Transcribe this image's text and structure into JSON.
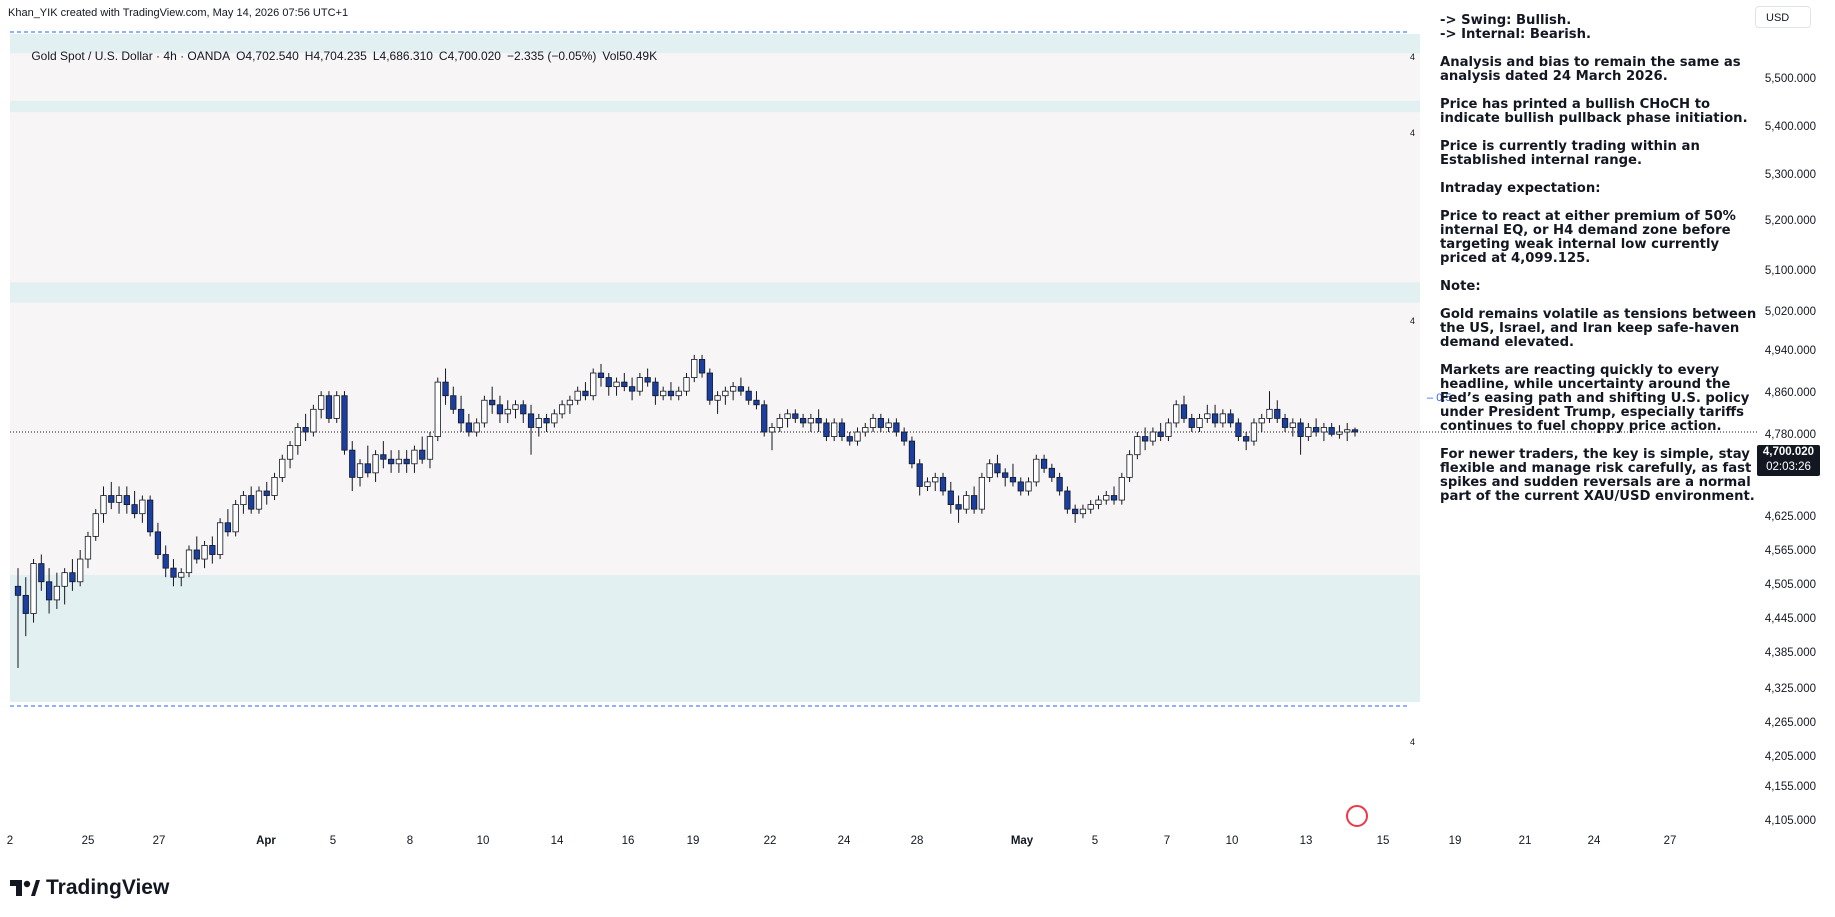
{
  "header": {
    "attribution": "Khan_YIK created with TradingView.com, May 14, 2026 07:56 UTC+1"
  },
  "symbol": {
    "name": "Gold Spot / U.S. Dollar · 4h · OANDA",
    "open": "O4,702.540",
    "high": "H4,704.235",
    "low": "L4,686.310",
    "close": "C4,700.020",
    "change": "−2.335 (−0.05%)",
    "volume": "Vol50.49K"
  },
  "currency": "USD",
  "price_axis": {
    "labels": [
      "5,500.000",
      "5,400.000",
      "5,300.000",
      "5,200.000",
      "5,100.000",
      "5,020.000",
      "4,940.000",
      "4,860.000",
      "4,780.000",
      "4,700.000",
      "4,625.000",
      "4,565.000",
      "4,505.000",
      "4,445.000",
      "4,385.000",
      "4,325.000",
      "4,265.000",
      "4,205.000",
      "4,155.000",
      "4,105.000"
    ],
    "last_price": "4,700.020",
    "countdown": "02:03:26"
  },
  "time_axis": {
    "labels": [
      {
        "text": "2",
        "bold": false
      },
      {
        "text": "25",
        "bold": false
      },
      {
        "text": "27",
        "bold": false
      },
      {
        "text": "Apr",
        "bold": true
      },
      {
        "text": "5",
        "bold": false
      },
      {
        "text": "8",
        "bold": false
      },
      {
        "text": "10",
        "bold": false
      },
      {
        "text": "14",
        "bold": false
      },
      {
        "text": "16",
        "bold": false
      },
      {
        "text": "19",
        "bold": false
      },
      {
        "text": "22",
        "bold": false
      },
      {
        "text": "24",
        "bold": false
      },
      {
        "text": "28",
        "bold": false
      },
      {
        "text": "May",
        "bold": true
      },
      {
        "text": "5",
        "bold": false
      },
      {
        "text": "7",
        "bold": false
      },
      {
        "text": "10",
        "bold": false
      },
      {
        "text": "13",
        "bold": false
      },
      {
        "text": "15",
        "bold": false
      },
      {
        "text": "19",
        "bold": false
      },
      {
        "text": "21",
        "bold": false
      },
      {
        "text": "24",
        "bold": false
      },
      {
        "text": "27",
        "bold": false
      }
    ]
  },
  "fib_level": "0.5",
  "zone_labels": [
    "4",
    "4",
    "4",
    "4"
  ],
  "analysis": {
    "lines": [
      "-> Swing:  Bullish.",
      "-> Internal:  Bearish.",
      "Analysis and bias to remain the same as analysis dated 24 March 2026.",
      "Price has printed a bullish CHoCH to indicate bullish pullback phase initiation.",
      "Price is currently trading within an Established internal range.",
      "Intraday expectation:",
      "Price to react at either premium of 50% internal EQ, or H4 demand zone before targeting weak internal low currently priced at 4,099.125.",
      "Note:",
      "Gold remains volatile as tensions between the US, Israel, and Iran keep safe-haven demand elevated.",
      "Markets are reacting quickly to every headline, while uncertainty around the Fed’s easing path and shifting U.S. policy under President Trump, especially tariffs continues to fuel choppy price action.",
      "For newer traders, the key is simple, stay flexible and manage risk carefully, as fast spikes and sudden reversals are a normal part of the current XAU/USD environment."
    ]
  },
  "footer": {
    "brand": "TradingView"
  },
  "colors": {
    "up": "#ffffff",
    "down": "#1a3fa0",
    "wick": "#131722",
    "zone": "#e3f0f2",
    "range_bg": "#f7f5f6",
    "dashed": "#2962ff"
  },
  "chart_data": {
    "type": "candlestick",
    "symbol": "XAUUSD",
    "interval": "4h",
    "ylim": [
      4105,
      5500
    ],
    "last": 4700.02,
    "zones": [
      {
        "top": 5580,
        "bottom": 5535
      },
      {
        "top": 5430,
        "bottom": 5405
      },
      {
        "top": 5030,
        "bottom": 4985
      },
      {
        "top": 4385,
        "bottom": 4105
      }
    ],
    "range_box": {
      "top": 5535,
      "bottom": 4385
    },
    "fib_mid": 4843,
    "candles": [
      [
        4360,
        4400,
        4180,
        4340
      ],
      [
        4340,
        4380,
        4250,
        4300
      ],
      [
        4300,
        4420,
        4280,
        4410
      ],
      [
        4410,
        4430,
        4350,
        4370
      ],
      [
        4370,
        4400,
        4300,
        4330
      ],
      [
        4330,
        4390,
        4310,
        4360
      ],
      [
        4360,
        4400,
        4320,
        4390
      ],
      [
        4390,
        4420,
        4350,
        4370
      ],
      [
        4370,
        4440,
        4360,
        4420
      ],
      [
        4420,
        4480,
        4400,
        4470
      ],
      [
        4470,
        4530,
        4460,
        4520
      ],
      [
        4520,
        4580,
        4500,
        4560
      ],
      [
        4560,
        4590,
        4530,
        4545
      ],
      [
        4545,
        4580,
        4520,
        4560
      ],
      [
        4560,
        4580,
        4520,
        4540
      ],
      [
        4540,
        4570,
        4510,
        4520
      ],
      [
        4520,
        4560,
        4500,
        4550
      ],
      [
        4550,
        4560,
        4470,
        4480
      ],
      [
        4480,
        4500,
        4420,
        4430
      ],
      [
        4430,
        4450,
        4380,
        4400
      ],
      [
        4400,
        4420,
        4360,
        4380
      ],
      [
        4380,
        4400,
        4360,
        4390
      ],
      [
        4390,
        4450,
        4380,
        4440
      ],
      [
        4440,
        4470,
        4410,
        4420
      ],
      [
        4420,
        4460,
        4400,
        4450
      ],
      [
        4450,
        4470,
        4410,
        4430
      ],
      [
        4430,
        4510,
        4420,
        4500
      ],
      [
        4500,
        4530,
        4470,
        4480
      ],
      [
        4480,
        4550,
        4470,
        4540
      ],
      [
        4540,
        4570,
        4520,
        4560
      ],
      [
        4560,
        4580,
        4520,
        4530
      ],
      [
        4530,
        4580,
        4520,
        4570
      ],
      [
        4570,
        4590,
        4540,
        4560
      ],
      [
        4560,
        4610,
        4550,
        4600
      ],
      [
        4600,
        4650,
        4590,
        4640
      ],
      [
        4640,
        4680,
        4620,
        4670
      ],
      [
        4670,
        4720,
        4650,
        4710
      ],
      [
        4710,
        4740,
        4680,
        4700
      ],
      [
        4700,
        4760,
        4690,
        4750
      ],
      [
        4750,
        4790,
        4730,
        4780
      ],
      [
        4780,
        4790,
        4720,
        4730
      ],
      [
        4730,
        4790,
        4720,
        4780
      ],
      [
        4780,
        4790,
        4650,
        4660
      ],
      [
        4660,
        4680,
        4570,
        4600
      ],
      [
        4600,
        4640,
        4580,
        4630
      ],
      [
        4630,
        4670,
        4600,
        4610
      ],
      [
        4610,
        4660,
        4590,
        4650
      ],
      [
        4650,
        4680,
        4620,
        4640
      ],
      [
        4640,
        4660,
        4610,
        4630
      ],
      [
        4630,
        4660,
        4610,
        4640
      ],
      [
        4640,
        4660,
        4610,
        4630
      ],
      [
        4630,
        4670,
        4610,
        4660
      ],
      [
        4660,
        4690,
        4630,
        4640
      ],
      [
        4640,
        4700,
        4620,
        4690
      ],
      [
        4690,
        4820,
        4680,
        4810
      ],
      [
        4810,
        4840,
        4760,
        4780
      ],
      [
        4780,
        4800,
        4740,
        4750
      ],
      [
        4750,
        4780,
        4700,
        4720
      ],
      [
        4720,
        4740,
        4690,
        4700
      ],
      [
        4700,
        4730,
        4690,
        4720
      ],
      [
        4720,
        4780,
        4710,
        4770
      ],
      [
        4770,
        4800,
        4740,
        4760
      ],
      [
        4760,
        4780,
        4720,
        4740
      ],
      [
        4740,
        4770,
        4720,
        4750
      ],
      [
        4750,
        4770,
        4730,
        4760
      ],
      [
        4760,
        4770,
        4720,
        4740
      ],
      [
        4740,
        4760,
        4650,
        4710
      ],
      [
        4710,
        4740,
        4690,
        4730
      ],
      [
        4730,
        4740,
        4700,
        4720
      ],
      [
        4720,
        4750,
        4710,
        4740
      ],
      [
        4740,
        4770,
        4730,
        4760
      ],
      [
        4760,
        4780,
        4740,
        4770
      ],
      [
        4770,
        4800,
        4760,
        4790
      ],
      [
        4790,
        4810,
        4770,
        4780
      ],
      [
        4780,
        4840,
        4770,
        4830
      ],
      [
        4830,
        4850,
        4800,
        4820
      ],
      [
        4820,
        4830,
        4780,
        4800
      ],
      [
        4800,
        4820,
        4780,
        4810
      ],
      [
        4810,
        4830,
        4790,
        4800
      ],
      [
        4800,
        4820,
        4770,
        4790
      ],
      [
        4790,
        4830,
        4780,
        4820
      ],
      [
        4820,
        4840,
        4800,
        4810
      ],
      [
        4810,
        4820,
        4760,
        4780
      ],
      [
        4780,
        4800,
        4770,
        4790
      ],
      [
        4790,
        4810,
        4770,
        4780
      ],
      [
        4780,
        4800,
        4770,
        4790
      ],
      [
        4790,
        4830,
        4780,
        4820
      ],
      [
        4820,
        4870,
        4810,
        4860
      ],
      [
        4860,
        4870,
        4820,
        4830
      ],
      [
        4830,
        4840,
        4760,
        4770
      ],
      [
        4770,
        4790,
        4740,
        4780
      ],
      [
        4780,
        4800,
        4760,
        4790
      ],
      [
        4790,
        4810,
        4770,
        4800
      ],
      [
        4800,
        4820,
        4780,
        4790
      ],
      [
        4790,
        4800,
        4760,
        4770
      ],
      [
        4770,
        4790,
        4750,
        4760
      ],
      [
        4760,
        4770,
        4690,
        4700
      ],
      [
        4700,
        4720,
        4660,
        4710
      ],
      [
        4710,
        4740,
        4700,
        4730
      ],
      [
        4730,
        4750,
        4710,
        4740
      ],
      [
        4740,
        4750,
        4720,
        4730
      ],
      [
        4730,
        4740,
        4710,
        4720
      ],
      [
        4720,
        4740,
        4700,
        4730
      ],
      [
        4730,
        4750,
        4700,
        4720
      ],
      [
        4720,
        4730,
        4680,
        4690
      ],
      [
        4690,
        4730,
        4680,
        4720
      ],
      [
        4720,
        4730,
        4680,
        4690
      ],
      [
        4690,
        4700,
        4670,
        4680
      ],
      [
        4680,
        4710,
        4670,
        4700
      ],
      [
        4700,
        4720,
        4690,
        4710
      ],
      [
        4710,
        4740,
        4700,
        4730
      ],
      [
        4730,
        4740,
        4700,
        4710
      ],
      [
        4710,
        4730,
        4700,
        4720
      ],
      [
        4720,
        4730,
        4690,
        4700
      ],
      [
        4700,
        4710,
        4670,
        4680
      ],
      [
        4680,
        4690,
        4620,
        4630
      ],
      [
        4630,
        4640,
        4560,
        4580
      ],
      [
        4580,
        4600,
        4570,
        4590
      ],
      [
        4590,
        4610,
        4570,
        4600
      ],
      [
        4600,
        4610,
        4560,
        4570
      ],
      [
        4570,
        4590,
        4520,
        4540
      ],
      [
        4540,
        4560,
        4500,
        4530
      ],
      [
        4530,
        4570,
        4520,
        4560
      ],
      [
        4560,
        4580,
        4520,
        4530
      ],
      [
        4530,
        4610,
        4520,
        4600
      ],
      [
        4600,
        4640,
        4590,
        4630
      ],
      [
        4630,
        4650,
        4600,
        4610
      ],
      [
        4610,
        4620,
        4580,
        4600
      ],
      [
        4600,
        4630,
        4580,
        4590
      ],
      [
        4590,
        4600,
        4560,
        4570
      ],
      [
        4570,
        4600,
        4560,
        4590
      ],
      [
        4590,
        4650,
        4580,
        4640
      ],
      [
        4640,
        4650,
        4610,
        4620
      ],
      [
        4620,
        4630,
        4590,
        4600
      ],
      [
        4600,
        4610,
        4560,
        4570
      ],
      [
        4570,
        4580,
        4520,
        4530
      ],
      [
        4530,
        4540,
        4500,
        4520
      ],
      [
        4520,
        4540,
        4510,
        4530
      ],
      [
        4530,
        4550,
        4520,
        4540
      ],
      [
        4540,
        4560,
        4530,
        4550
      ],
      [
        4550,
        4570,
        4540,
        4560
      ],
      [
        4560,
        4580,
        4540,
        4550
      ],
      [
        4550,
        4610,
        4540,
        4600
      ],
      [
        4600,
        4660,
        4590,
        4650
      ],
      [
        4650,
        4700,
        4640,
        4690
      ],
      [
        4690,
        4710,
        4660,
        4680
      ],
      [
        4680,
        4710,
        4670,
        4700
      ],
      [
        4700,
        4720,
        4680,
        4690
      ],
      [
        4690,
        4730,
        4680,
        4720
      ],
      [
        4720,
        4770,
        4710,
        4760
      ],
      [
        4760,
        4780,
        4720,
        4730
      ],
      [
        4730,
        4740,
        4700,
        4710
      ],
      [
        4710,
        4740,
        4700,
        4730
      ],
      [
        4730,
        4760,
        4720,
        4740
      ],
      [
        4740,
        4760,
        4710,
        4720
      ],
      [
        4720,
        4750,
        4710,
        4740
      ],
      [
        4740,
        4750,
        4710,
        4720
      ],
      [
        4720,
        4730,
        4680,
        4690
      ],
      [
        4690,
        4700,
        4660,
        4680
      ],
      [
        4680,
        4730,
        4670,
        4720
      ],
      [
        4720,
        4740,
        4700,
        4730
      ],
      [
        4730,
        4790,
        4720,
        4750
      ],
      [
        4750,
        4770,
        4720,
        4730
      ],
      [
        4730,
        4740,
        4700,
        4710
      ],
      [
        4710,
        4730,
        4690,
        4720
      ],
      [
        4720,
        4730,
        4650,
        4690
      ],
      [
        4690,
        4720,
        4680,
        4710
      ],
      [
        4710,
        4730,
        4690,
        4700
      ],
      [
        4700,
        4720,
        4680,
        4710
      ],
      [
        4710,
        4720,
        4690,
        4695
      ],
      [
        4695,
        4715,
        4685,
        4700
      ],
      [
        4700,
        4720,
        4680,
        4705
      ],
      [
        4705,
        4710,
        4690,
        4700
      ]
    ]
  }
}
